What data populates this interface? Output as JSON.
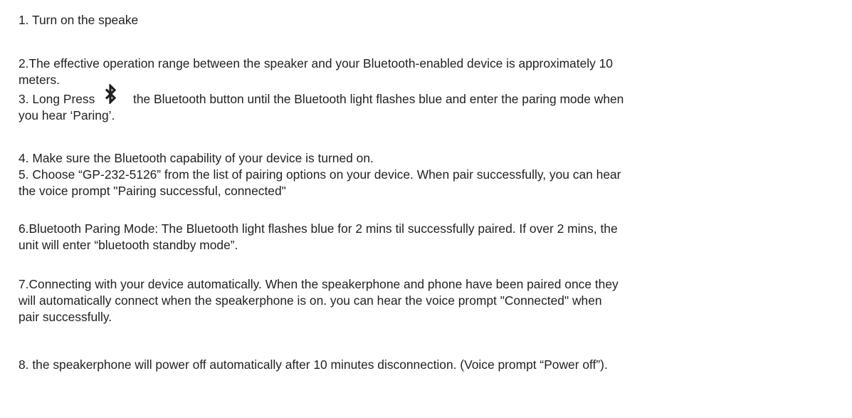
{
  "instructions": {
    "step1": {
      "line1": "1. Turn on the speake"
    },
    "step2": {
      "line1": "2.The effective operation range between the speaker and your Bluetooth-enabled device is approximately 10",
      "line2": "meters."
    },
    "step3": {
      "prefix": "3. Long Press",
      "icon": "bluetooth-icon",
      "suffix": "the Bluetooth button until the Bluetooth light flashes blue and enter the paring mode when",
      "line2": "you hear ‘Paring’."
    },
    "step4": {
      "line1": "4. Make sure the Bluetooth capability of your device is turned on."
    },
    "step5": {
      "line1": "5. Choose “GP-232-5126” from the list of pairing options on your device. When pair successfully, you can hear",
      "line2": "the voice prompt \"Pairing successful, connected\""
    },
    "step6": {
      "line1": "6.Bluetooth Paring Mode: The Bluetooth light flashes blue for 2 mins til successfully paired. If over 2 mins, the",
      "line2": "unit will enter “bluetooth standby mode”."
    },
    "step7": {
      "line1": "7.Connecting with your device automatically. When the speakerphone and phone have been paired once they",
      "line2": "will automatically connect when the speakerphone is on. you can hear the voice prompt \"Connected\" when",
      "line3": "pair successfully."
    },
    "step8": {
      "line1": "8. the speakerphone will power off automatically after 10 minutes disconnection. (Voice prompt “Power off”)."
    }
  }
}
